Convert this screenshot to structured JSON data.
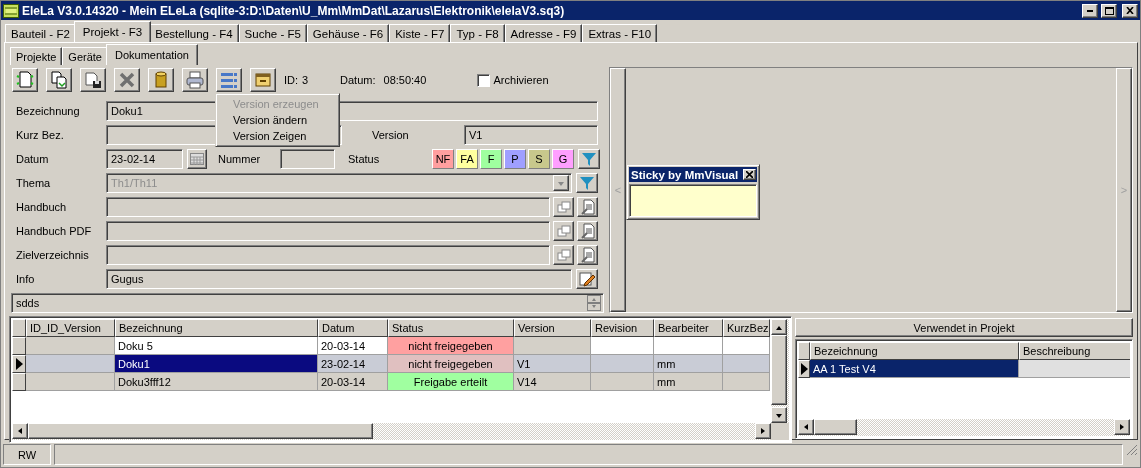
{
  "window": {
    "title": "EleLa V3.0.14320  - Mein ELeLa (sqlite-3:D:\\Daten\\U_Mm\\MmDat\\Lazarus\\Elektronik\\elelaV3.sq3)"
  },
  "main_tabs": [
    {
      "label": "Bauteil - F2",
      "selected": false
    },
    {
      "label": "Projekt - F3",
      "selected": true
    },
    {
      "label": "Bestellung - F4",
      "selected": false
    },
    {
      "label": "Suche - F5",
      "selected": false
    },
    {
      "label": "Gehäuse - F6",
      "selected": false
    },
    {
      "label": "Kiste - F7",
      "selected": false
    },
    {
      "label": "Typ - F8",
      "selected": false
    },
    {
      "label": "Adresse - F9",
      "selected": false
    },
    {
      "label": "Extras - F10",
      "selected": false
    }
  ],
  "sub_tabs": [
    {
      "label": "Projekte",
      "selected": false
    },
    {
      "label": "Geräte",
      "selected": false
    },
    {
      "label": "Dokumentation",
      "selected": true
    }
  ],
  "toolbar": {
    "id_label": "ID:",
    "id_value": "3",
    "datum_label": "Datum:",
    "datum_value": "08:50:40",
    "archive": {
      "label": "Archivieren",
      "checked": false
    }
  },
  "popup_menu": [
    {
      "label": "Version erzeugen",
      "disabled": true
    },
    {
      "label": "Version ändern",
      "disabled": false
    },
    {
      "label": "Version Zeigen",
      "disabled": false
    }
  ],
  "form": {
    "bezeichnung": {
      "label": "Bezeichnung",
      "value": "Doku1"
    },
    "kurz_bez": {
      "label": "Kurz Bez."
    },
    "version": {
      "label": "Version",
      "value": "V1"
    },
    "datum": {
      "label": "Datum",
      "value": "23-02-14"
    },
    "nummer": {
      "label": "Nummer"
    },
    "status": {
      "label": "Status",
      "buttons": [
        {
          "label": "NF",
          "color": "#ff9f9f"
        },
        {
          "label": "FA",
          "color": "#ffff9f"
        },
        {
          "label": "F",
          "color": "#9fff9f"
        },
        {
          "label": "P",
          "color": "#9f9fff"
        },
        {
          "label": "S",
          "color": "#c8c88c"
        },
        {
          "label": "G",
          "color": "#ff9fff"
        }
      ]
    },
    "thema": {
      "label": "Thema",
      "value": "Th1/Th11",
      "disabled": true
    },
    "handbuch": {
      "label": "Handbuch"
    },
    "handbuch_pdf": {
      "label": "Handbuch PDF"
    },
    "zielverzeichnis": {
      "label": "Zielverzeichnis"
    },
    "info": {
      "label": "Info",
      "value": "Gugus"
    },
    "notes": {
      "value": "sdds"
    }
  },
  "side_panel": {
    "prev_button": "<",
    "next_button": ">",
    "sticky": {
      "title": "Sticky by MmVisual"
    }
  },
  "table": {
    "columns": [
      "ID_ID_Version",
      "Bezeichnung",
      "Datum",
      "Status",
      "Version",
      "Revision",
      "Bearbeiter",
      "KurzBez"
    ],
    "rows": [
      {
        "kind": "new",
        "selected": false,
        "bezeichnung": "Doku 5",
        "datum": "20-03-14",
        "status": "nicht freigegeben",
        "color": "#ffa0a0"
      },
      {
        "kind": "stored",
        "selected": true,
        "bezeichnung": "Doku1",
        "datum": "23-02-14",
        "status": "nicht freigegeben",
        "version": "V1",
        "bearbeiter": "mm",
        "color": "#e0c0c0"
      },
      {
        "kind": "stored",
        "selected": false,
        "bezeichnung": "Doku3fff12",
        "datum": "20-03-14",
        "status": "Freigabe erteilt",
        "version": "V14",
        "bearbeiter": "mm",
        "color": "#a0ffa0"
      }
    ]
  },
  "used_in": {
    "title": "Verwendet in Projekt",
    "columns": [
      "Bezeichnung",
      "Beschreibung"
    ],
    "rows": [
      {
        "bezeichnung": "AA 1 Test V4",
        "selected": true
      }
    ]
  },
  "status_bar": {
    "mode": "RW"
  }
}
